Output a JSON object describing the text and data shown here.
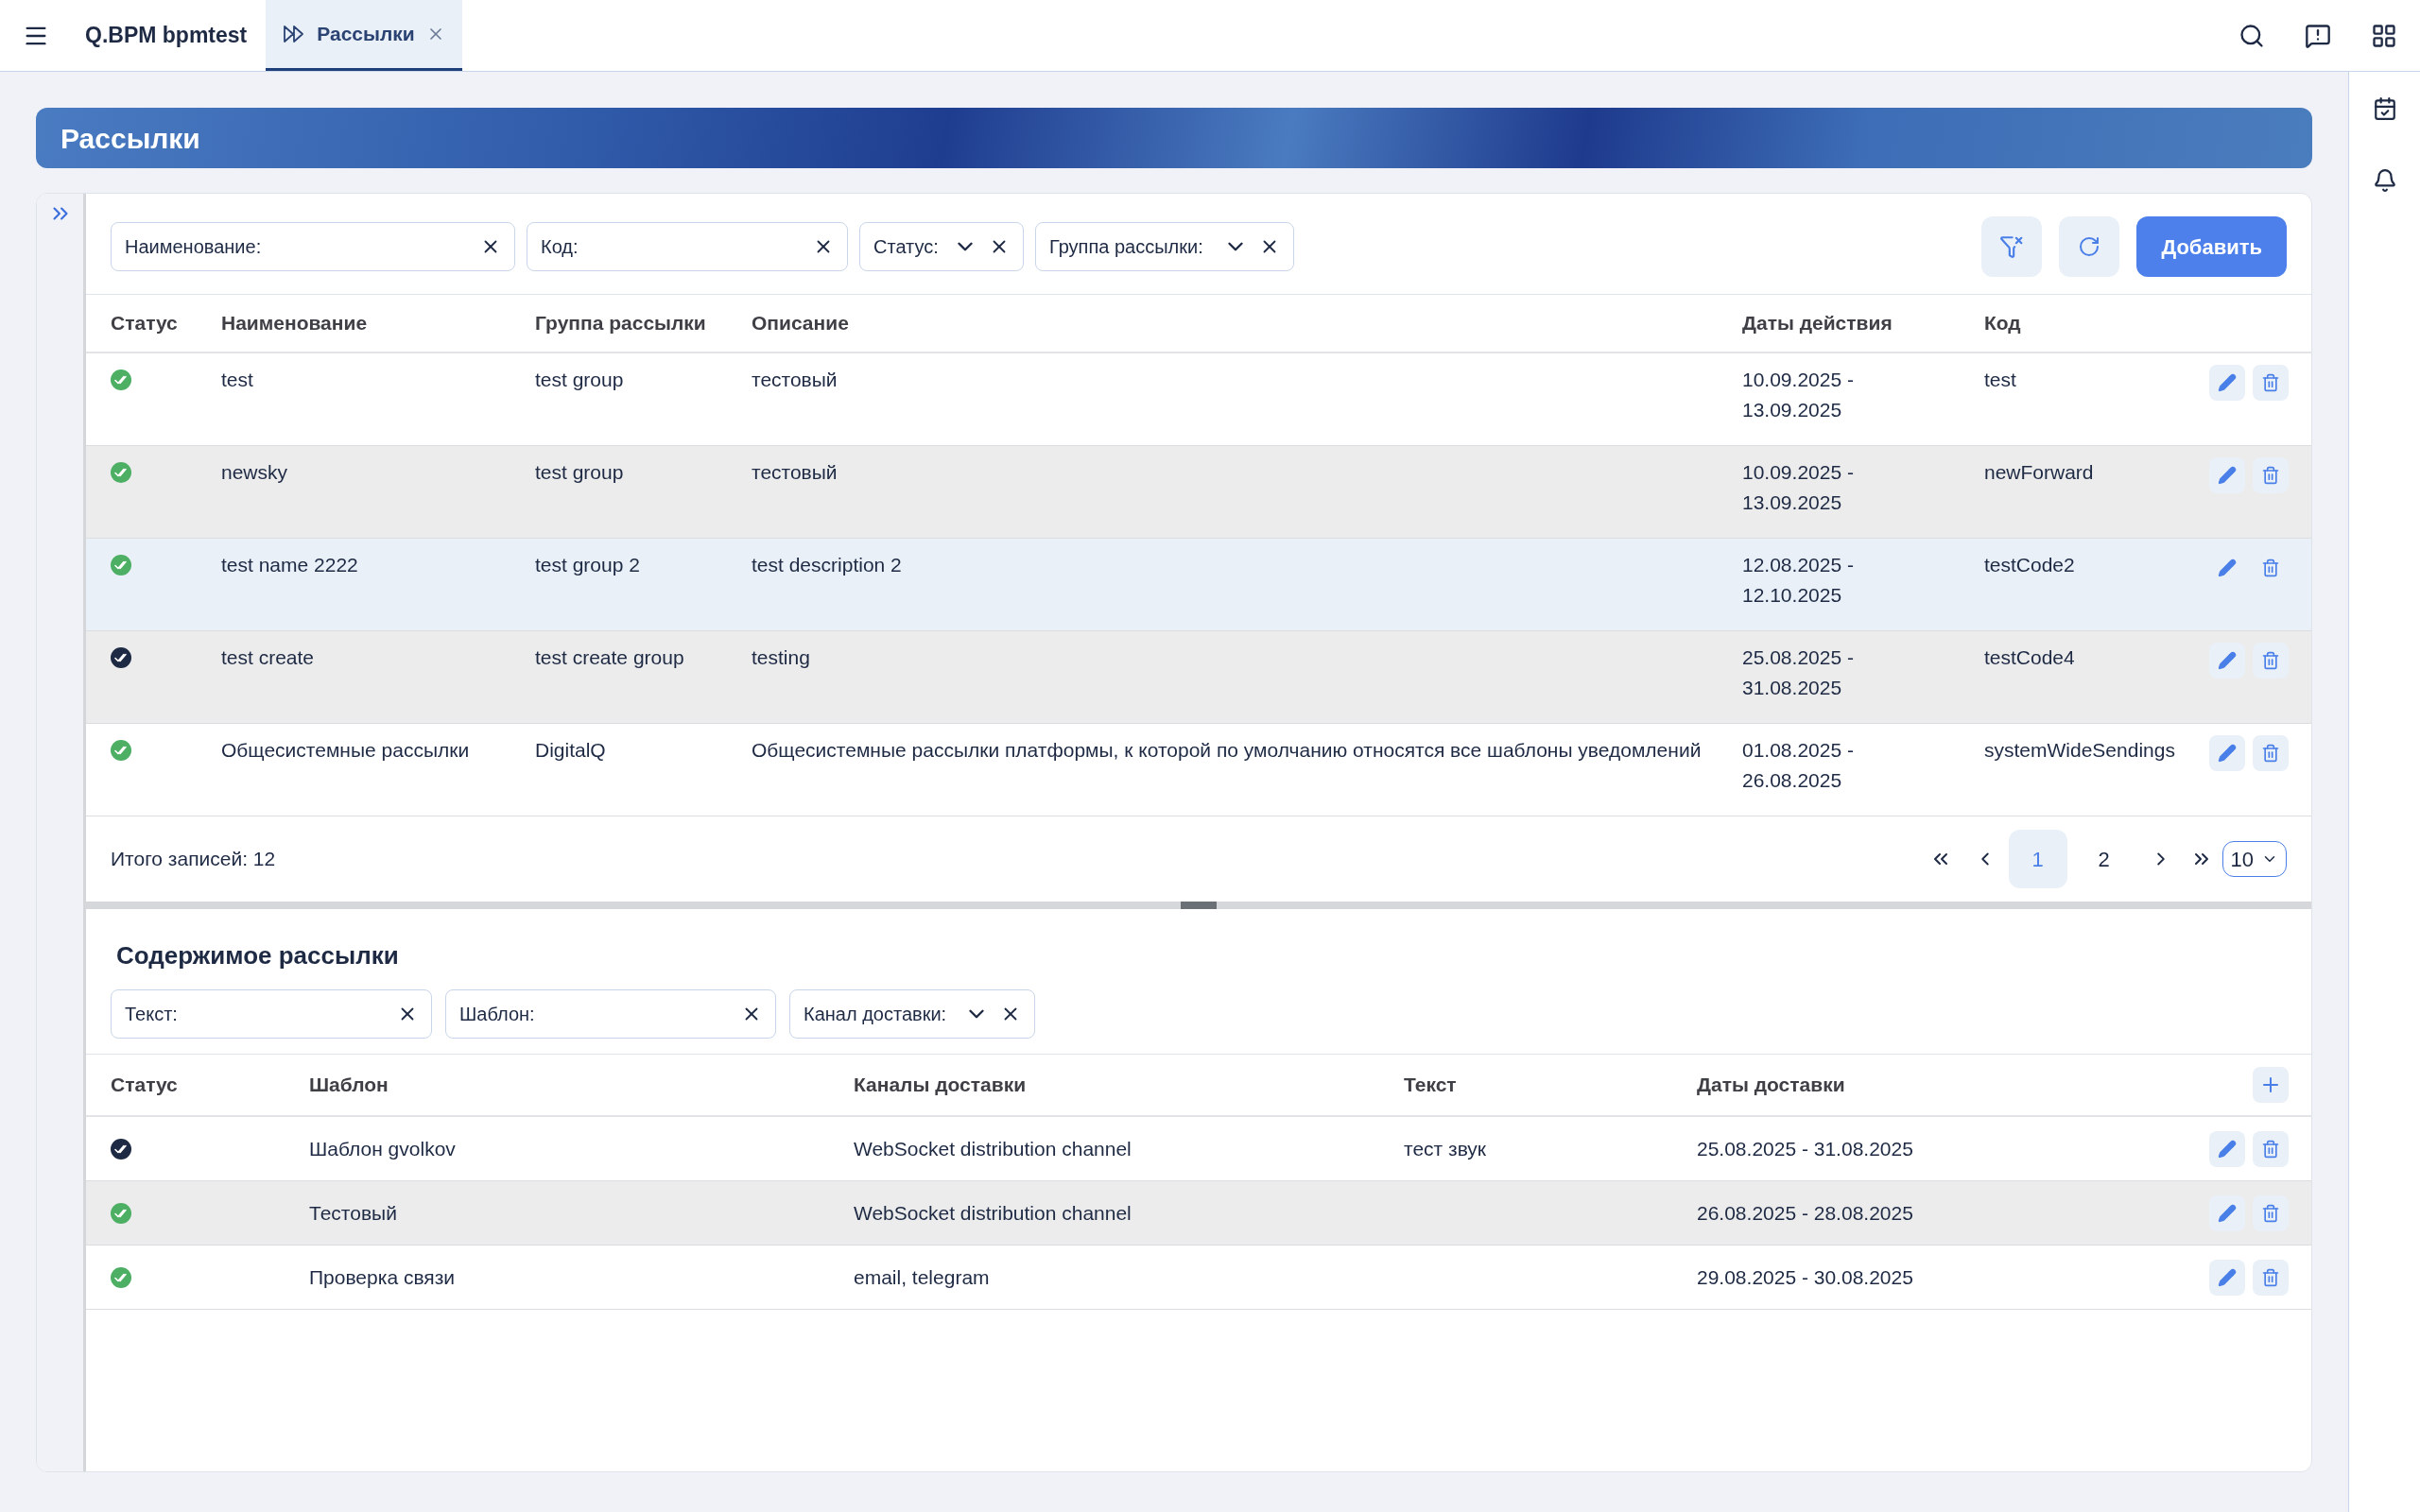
{
  "app": {
    "title": "Q.BPM bpmtest"
  },
  "tabs": [
    {
      "label": "Рассылки",
      "selected": true
    }
  ],
  "page_title": "Рассылки",
  "filters": [
    {
      "label": "Наименование:",
      "kind": "text"
    },
    {
      "label": "Код:",
      "kind": "text"
    },
    {
      "label": "Статус:",
      "kind": "select"
    },
    {
      "label": "Группа рассылки:",
      "kind": "select"
    }
  ],
  "add_button": "Добавить",
  "table": {
    "columns": [
      "Статус",
      "Наименование",
      "Группа рассылки",
      "Описание",
      "Даты действия",
      "Код"
    ],
    "rows": [
      {
        "active": true,
        "selected": false,
        "name": "test",
        "group": "test group",
        "description": "тестовый",
        "dates": "10.09.2025 - 13.09.2025",
        "code": "test"
      },
      {
        "active": true,
        "selected": false,
        "name": "newsky",
        "group": "test group",
        "description": "тестовый",
        "dates": "10.09.2025 - 13.09.2025",
        "code": "newForward"
      },
      {
        "active": true,
        "selected": true,
        "name": "test name 2222",
        "group": "test group 2",
        "description": "test description 2",
        "dates": "12.08.2025 - 12.10.2025",
        "code": "testCode2"
      },
      {
        "active": false,
        "selected": false,
        "name": "test create",
        "group": "test create group",
        "description": "testing",
        "dates": "25.08.2025 - 31.08.2025",
        "code": "testCode4"
      },
      {
        "active": true,
        "selected": false,
        "name": "Общесистемные рассылки",
        "group": "DigitalQ",
        "description": "Общесистемные рассылки платформы, к которой по умолчанию относятся все шаблоны уведомлений",
        "dates": "01.08.2025 - 26.08.2025",
        "code": "systemWideSendings"
      }
    ]
  },
  "total": "Итого записей: 12",
  "pagination": {
    "pages": [
      {
        "label": "1",
        "selected": true
      },
      {
        "label": "2",
        "selected": false
      }
    ],
    "page_size": "10"
  },
  "content": {
    "title": "Содержимое рассылки",
    "filters": [
      {
        "label": "Текст:",
        "kind": "text"
      },
      {
        "label": "Шаблон:",
        "kind": "text"
      },
      {
        "label": "Канал доставки:",
        "kind": "select"
      }
    ],
    "table": {
      "columns": [
        "Статус",
        "Шаблон",
        "Каналы доставки",
        "Текст",
        "Даты доставки"
      ],
      "rows": [
        {
          "active": false,
          "template": "Шаблон gvolkov",
          "channels": "WebSocket distribution channel",
          "text": "тест звук",
          "dates": "25.08.2025 - 31.08.2025"
        },
        {
          "active": true,
          "template": "Тестовый",
          "channels": "WebSocket distribution channel",
          "dates": "26.08.2025 - 28.08.2025"
        },
        {
          "active": true,
          "template": "Проверка связи",
          "channels": "email, telegram",
          "dates": "29.08.2025 - 30.08.2025"
        }
      ]
    }
  }
}
